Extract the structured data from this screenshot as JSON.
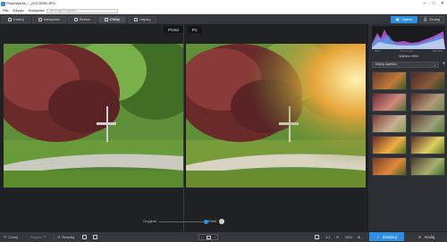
{
  "window": {
    "title": "PhotoWorks – _DSC0266.JPG",
    "controls": [
      "–",
      "□",
      "✕"
    ]
  },
  "menu": {
    "items": [
      "Plik",
      "Edycja",
      "Narzędzia",
      "Pomoc",
      "Widok",
      "Pomoc"
    ],
    "search_placeholder": "Jak mogę Ci pomóc..."
  },
  "toolbar": {
    "tabs": [
      {
        "label": "Kadruj",
        "icon": "crop-icon"
      },
      {
        "label": "Narzędzia",
        "icon": "tools-icon"
      },
      {
        "label": "Retusz",
        "icon": "brush-icon"
      },
      {
        "label": "Efekty",
        "icon": "effects-icon",
        "active": true
      },
      {
        "label": "Napisy",
        "icon": "text-icon"
      }
    ],
    "save_label": "Zapisz",
    "print_label": "Drukuj"
  },
  "compare": {
    "before_label": "Przed",
    "after_label": "Po"
  },
  "strength": {
    "left_label": "Oryginał",
    "right_label": "Efekt",
    "value_fraction": 0.96
  },
  "panel": {
    "histogram_caption_left": "f/2.8",
    "histogram_caption_mid": "70 mm  1/4",
    "histogram_caption_right": "ISO 160",
    "section_title": "Wybierz efekt",
    "category_value": "Efekty świetlne",
    "add_label": "+"
  },
  "statusbar": {
    "undo_label": "Cofnij",
    "redo_label": "Ponów",
    "reset_label": "Resetuj",
    "zoom_ratio": "1:1",
    "zoom_percent": "24%"
  },
  "footer": {
    "done_label": "Zastosuj",
    "cancel_label": "Anuluj"
  },
  "colors": {
    "accent": "#2e8ee0",
    "panel": "#2c2f33",
    "workspace": "#1f2124"
  }
}
